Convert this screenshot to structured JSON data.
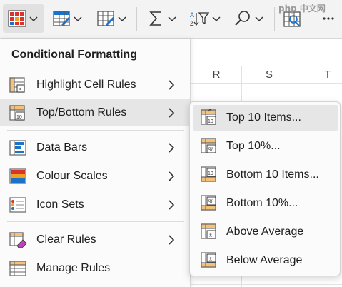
{
  "toolbar": {
    "buttons": [
      {
        "icon": "conditional-formatting-icon"
      },
      {
        "icon": "format-as-table-icon"
      },
      {
        "icon": "cell-styles-icon"
      },
      {
        "icon": "autosum-icon"
      },
      {
        "icon": "sort-filter-icon"
      },
      {
        "icon": "find-select-icon"
      },
      {
        "icon": "analyze-data-icon"
      },
      {
        "icon": "more-icon"
      }
    ],
    "watermark": "php 中文网"
  },
  "sheet": {
    "columns": [
      "R",
      "S",
      "T"
    ]
  },
  "menu": {
    "title": "Conditional Formatting",
    "items": [
      {
        "label": "Highlight Cell Rules",
        "icon": "highlight-cell-rules-icon",
        "has_submenu": true
      },
      {
        "label": "Top/Bottom Rules",
        "icon": "top-bottom-rules-icon",
        "has_submenu": true,
        "selected": true
      },
      {
        "label": "Data Bars",
        "icon": "data-bars-icon",
        "has_submenu": true
      },
      {
        "label": "Colour Scales",
        "icon": "colour-scales-icon",
        "has_submenu": true
      },
      {
        "label": "Icon Sets",
        "icon": "icon-sets-icon",
        "has_submenu": true
      },
      {
        "label": "Clear Rules",
        "icon": "clear-rules-icon",
        "has_submenu": true
      },
      {
        "label": "Manage Rules",
        "icon": "manage-rules-icon",
        "has_submenu": false
      }
    ]
  },
  "submenu": {
    "items": [
      {
        "label": "Top 10 Items...",
        "icon": "top-10-items-icon",
        "selected": true
      },
      {
        "label": "Top 10%...",
        "icon": "top-10-percent-icon"
      },
      {
        "label": "Bottom 10 Items...",
        "icon": "bottom-10-items-icon"
      },
      {
        "label": "Bottom 10%...",
        "icon": "bottom-10-percent-icon"
      },
      {
        "label": "Above Average",
        "icon": "above-average-icon"
      },
      {
        "label": "Below Average",
        "icon": "below-average-icon"
      }
    ]
  },
  "colors": {
    "accent_orange": "#f0a020",
    "accent_blue": "#1a73c8",
    "accent_red": "#d9342b",
    "menu_bg": "#fbfbfb",
    "selected_bg": "#e6e6e6"
  }
}
